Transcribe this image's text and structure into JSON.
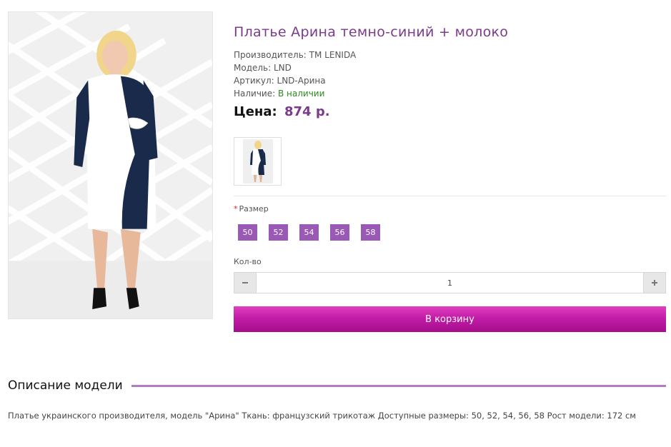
{
  "product": {
    "title": "Платье Арина темно-синий + молоко",
    "manufacturer_label": "Производитель:",
    "manufacturer_value": "TM LENIDA",
    "model_label": "Модель:",
    "model_value": "LND",
    "sku_label": "Артикул:",
    "sku_value": "LND-Арина",
    "availability_label": "Наличие:",
    "availability_value": "В наличии",
    "price_label": "Цена:",
    "price_value": "874 р."
  },
  "options": {
    "size_required_mark": "*",
    "size_label": "Размер",
    "sizes": [
      "50",
      "52",
      "54",
      "56",
      "58"
    ],
    "qty_label": "Кол-во",
    "qty_value": "1",
    "qty_minus_icon": "minus-icon",
    "qty_plus_icon": "plus-icon"
  },
  "cart": {
    "button_label": "В корзину"
  },
  "description": {
    "heading": "Описание модели",
    "text": "Платье украинского производителя, модель \"Арина\" Ткань: французский трикотаж Доступные размеры: 50, 52, 54, 56, 58 Рост модели: 172 см"
  },
  "colors": {
    "title": "#7b3a8c",
    "price_value": "#7b3a8c",
    "available": "#2e8b1e",
    "size_button": "#9b59b6",
    "cart_button": "#c21ca6",
    "accent_line": "#b07cc6"
  }
}
